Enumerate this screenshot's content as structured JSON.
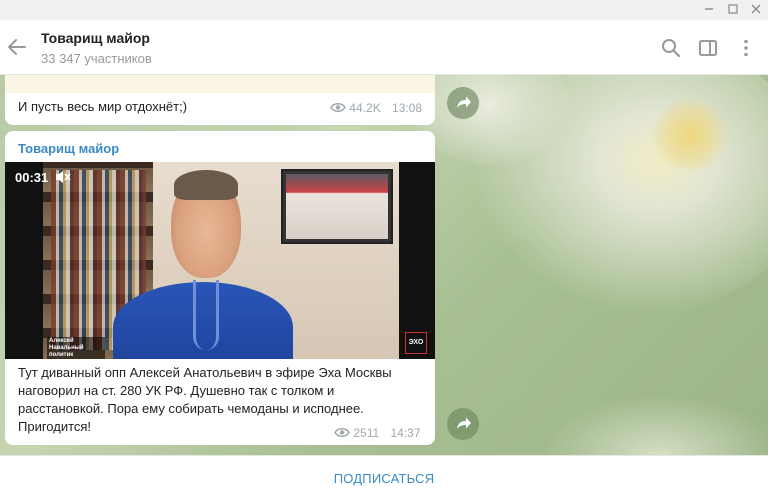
{
  "header": {
    "title": "Товарищ майор",
    "subtitle": "33 347 участников"
  },
  "messages": [
    {
      "text": "И пусть весь мир отдохнёт;)",
      "views": "44.2K",
      "time": "13:08"
    },
    {
      "sender": "Товарищ майор",
      "video": {
        "duration": "00:31",
        "overlay_label": "Алексей Навальный\nполитик",
        "logo": "ЭХО"
      },
      "caption": "Тут диванный опп Алексей Анатольевич в эфире Эха Москвы наговорил на ст. 280 УК РФ. Душевно так с толком и расстановкой. Пора ему собирать чемоданы и исподнее. Пригодится!",
      "views": "2511",
      "time": "14:37"
    }
  ],
  "footer": {
    "subscribe_label": "ПОДПИСАТЬСЯ"
  },
  "colors": {
    "accent": "#3a8bc7",
    "meta": "#a0a8ae"
  }
}
